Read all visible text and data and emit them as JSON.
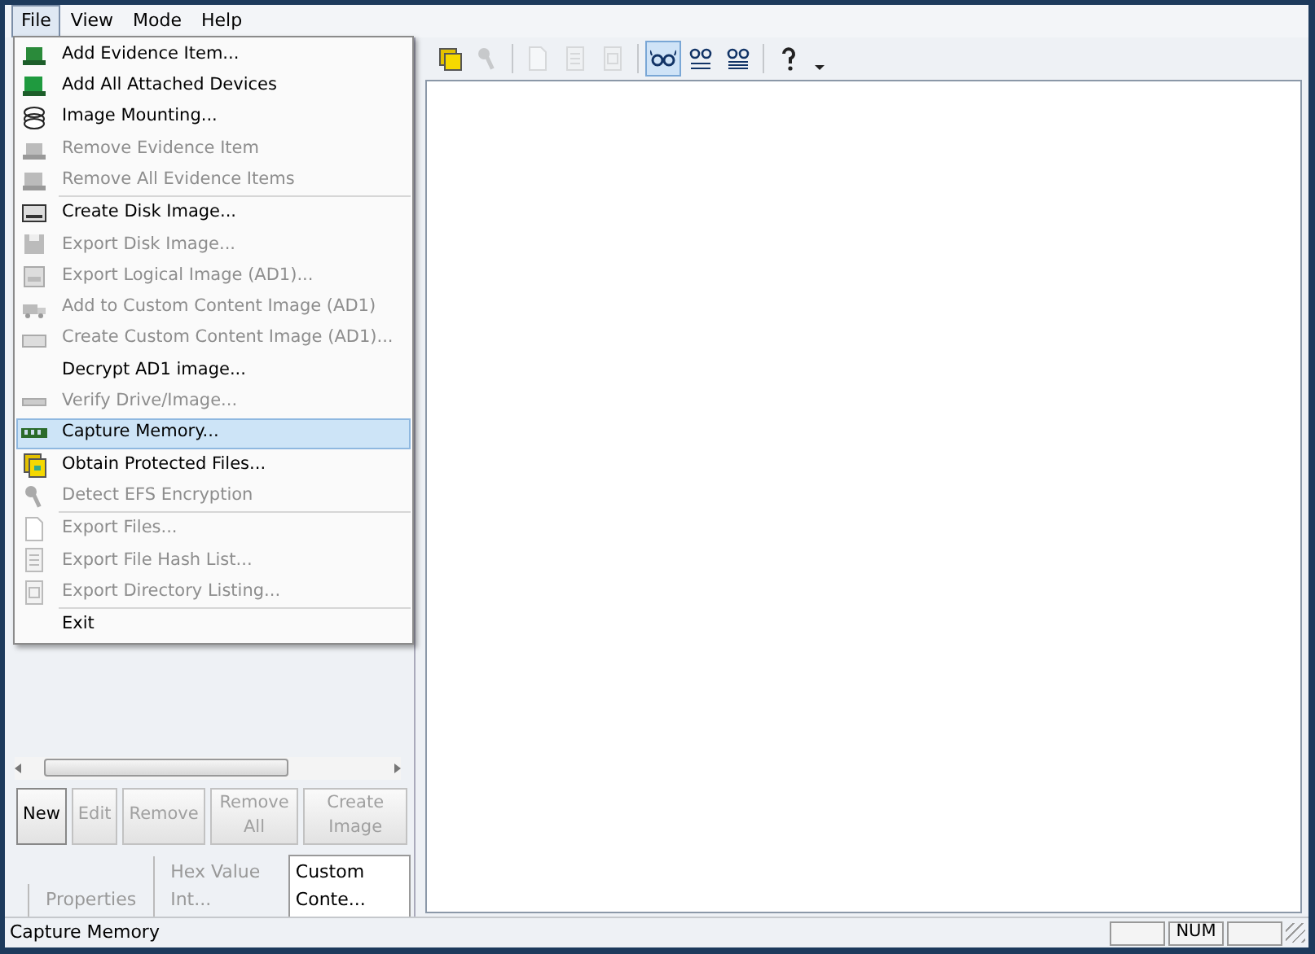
{
  "menubar": [
    {
      "label": "File",
      "selected": true
    },
    {
      "label": "View",
      "selected": false
    },
    {
      "label": "Mode",
      "selected": false
    },
    {
      "label": "Help",
      "selected": false
    }
  ],
  "file_menu": [
    [
      {
        "label": "Add Evidence Item...",
        "disabled": false,
        "selected": false
      },
      {
        "label": "Add All Attached Devices",
        "disabled": false,
        "selected": false
      },
      {
        "label": "Image Mounting...",
        "disabled": false,
        "selected": false
      },
      {
        "label": "Remove Evidence Item",
        "disabled": true,
        "selected": false
      },
      {
        "label": "Remove All Evidence Items",
        "disabled": true,
        "selected": false
      }
    ],
    [
      {
        "label": "Create Disk Image...",
        "disabled": false,
        "selected": false
      },
      {
        "label": "Export Disk Image...",
        "disabled": true,
        "selected": false
      },
      {
        "label": "Export Logical Image (AD1)...",
        "disabled": true,
        "selected": false
      },
      {
        "label": "Add to Custom Content Image (AD1)",
        "disabled": true,
        "selected": false
      },
      {
        "label": "Create Custom Content Image (AD1)...",
        "disabled": true,
        "selected": false
      },
      {
        "label": "Decrypt AD1 image...",
        "disabled": false,
        "selected": false
      },
      {
        "label": "Verify Drive/Image...",
        "disabled": true,
        "selected": false
      },
      {
        "label": "Capture Memory...",
        "disabled": false,
        "selected": true
      },
      {
        "label": "Obtain Protected Files...",
        "disabled": false,
        "selected": false
      },
      {
        "label": "Detect EFS Encryption",
        "disabled": true,
        "selected": false
      }
    ],
    [
      {
        "label": "Export Files...",
        "disabled": true,
        "selected": false
      },
      {
        "label": "Export File Hash List...",
        "disabled": true,
        "selected": false
      },
      {
        "label": "Export Directory Listing...",
        "disabled": true,
        "selected": false
      }
    ],
    [
      {
        "label": "Exit",
        "disabled": false,
        "selected": false
      }
    ]
  ],
  "toolbar": [
    [
      {
        "disabled": false,
        "selected": false
      },
      {
        "disabled": true,
        "selected": false
      }
    ],
    [
      {
        "disabled": true,
        "selected": false
      },
      {
        "disabled": true,
        "selected": false
      },
      {
        "disabled": true,
        "selected": false
      }
    ],
    [
      {
        "disabled": false,
        "selected": true
      },
      {
        "disabled": false,
        "selected": false
      },
      {
        "disabled": false,
        "selected": false
      }
    ],
    [
      {
        "disabled": false,
        "selected": false
      }
    ]
  ],
  "left_buttons": [
    {
      "label": "New",
      "disabled": false
    },
    {
      "label": "Edit",
      "disabled": true
    },
    {
      "label": "Remove",
      "disabled": true
    },
    {
      "label": "Remove All",
      "disabled": true
    },
    {
      "label": "Create Image",
      "disabled": true
    }
  ],
  "left_tabs": [
    {
      "label": "Properties",
      "selected": false
    },
    {
      "label": "Hex Value Int...",
      "selected": false
    },
    {
      "label": "Custom Conte...",
      "selected": true
    }
  ],
  "status_bar": {
    "text": "Capture Memory",
    "panels": [
      "NUM"
    ]
  }
}
